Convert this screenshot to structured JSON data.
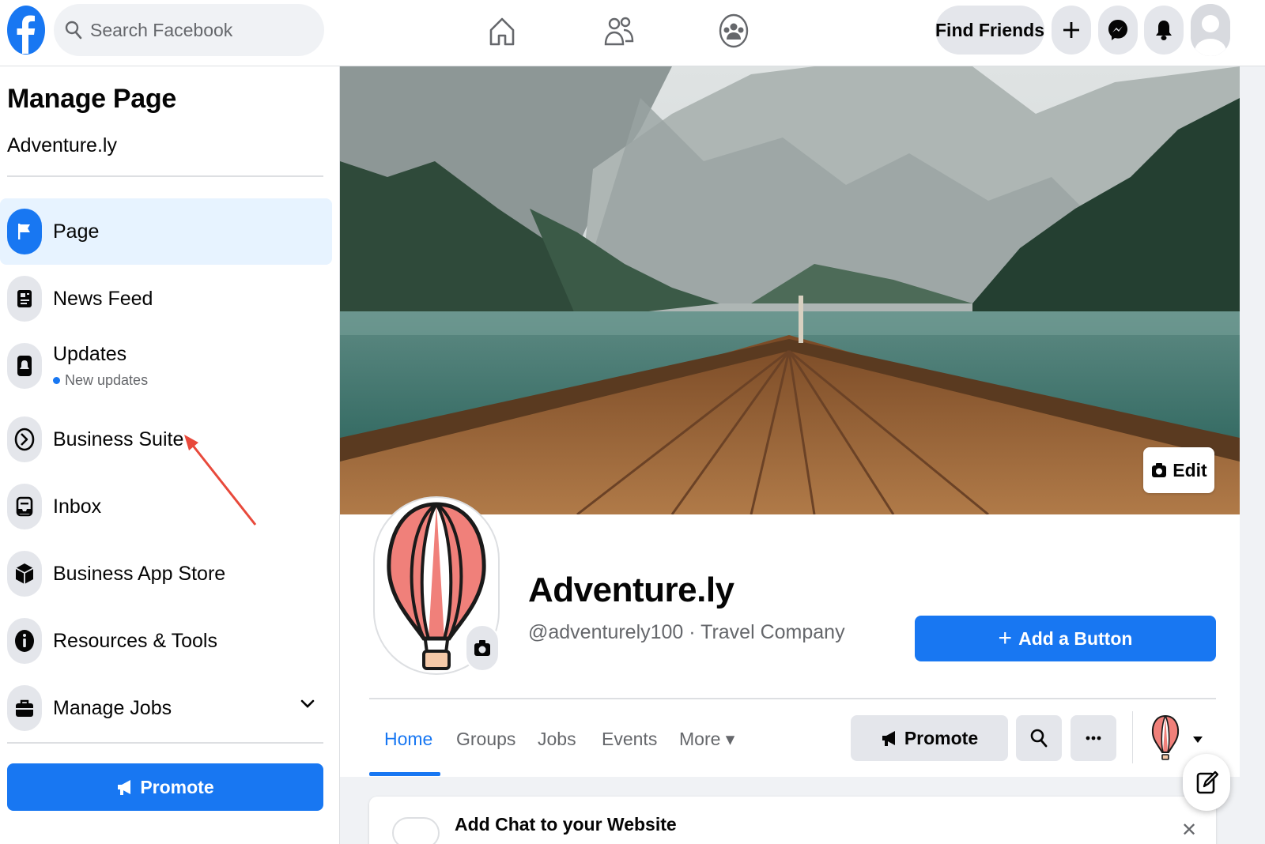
{
  "topbar": {
    "search_placeholder": "Search Facebook",
    "nav_icons": [
      "home-icon",
      "friends-icon",
      "groups-icon"
    ],
    "find_friends_label": "Find Friends",
    "right_icons": [
      "plus-icon",
      "messenger-icon",
      "bell-icon",
      "avatar-icon"
    ]
  },
  "sidebar": {
    "title": "Manage Page",
    "page_name": "Adventure.ly",
    "items": [
      {
        "label": "Page",
        "icon": "flag-icon",
        "active": true
      },
      {
        "label": "News Feed",
        "icon": "news-feed-icon"
      },
      {
        "label": "Updates",
        "icon": "bell-icon",
        "note": "New updates"
      },
      {
        "label": "Business Suite",
        "icon": "business-suite-icon"
      },
      {
        "label": "Inbox",
        "icon": "inbox-icon"
      },
      {
        "label": "Business App Store",
        "icon": "cube-icon"
      },
      {
        "label": "Resources & Tools",
        "icon": "info-icon"
      },
      {
        "label": "Manage Jobs",
        "icon": "briefcase-icon",
        "expandable": true
      }
    ],
    "promote_label": "Promote"
  },
  "main": {
    "edit_label": "Edit",
    "page_name": "Adventure.ly",
    "page_handle": "@adventurely100 · Travel Company",
    "add_button_label": "Add a Button",
    "tabs": [
      {
        "label": "Home",
        "active": true
      },
      {
        "label": "Groups"
      },
      {
        "label": "Jobs"
      },
      {
        "label": "Events"
      },
      {
        "label": "More ▾"
      }
    ],
    "promote_label": "Promote",
    "chat_card_title": "Add Chat to your Website"
  },
  "colors": {
    "brand_blue": "#1877f2",
    "active_bg": "#e7f3ff",
    "annotation_arrow": "#e8493b"
  }
}
